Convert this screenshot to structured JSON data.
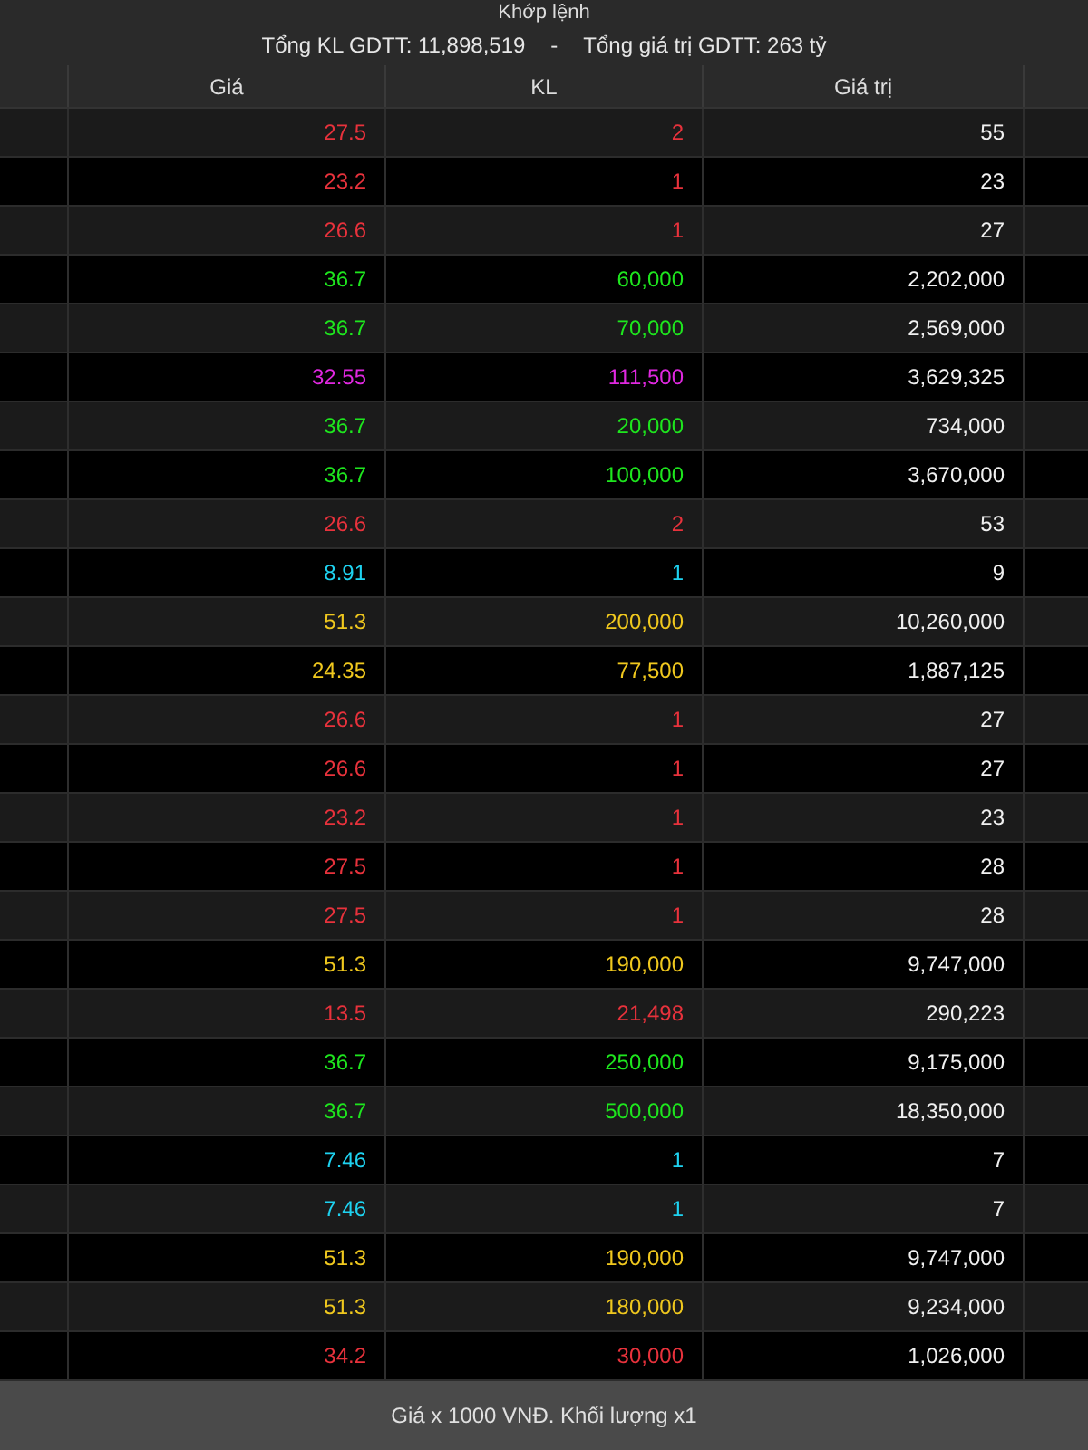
{
  "title": "Khớp lệnh",
  "summary": {
    "total_volume": "Tổng KL GDTT: 11,898,519",
    "separator": "-",
    "total_value": "Tổng giá trị GDTT: 263 tỷ"
  },
  "table": {
    "columns": [
      "Giá",
      "KL",
      "Giá trị"
    ],
    "rows": [
      {
        "price": "27.5",
        "volume": "2",
        "value": "55",
        "color": "#e8323c"
      },
      {
        "price": "23.2",
        "volume": "1",
        "value": "23",
        "color": "#e8323c"
      },
      {
        "price": "26.6",
        "volume": "1",
        "value": "27",
        "color": "#e8323c"
      },
      {
        "price": "36.7",
        "volume": "60,000",
        "value": "2,202,000",
        "color": "#1ee61e"
      },
      {
        "price": "36.7",
        "volume": "70,000",
        "value": "2,569,000",
        "color": "#1ee61e"
      },
      {
        "price": "32.55",
        "volume": "111,500",
        "value": "3,629,325",
        "color": "#e028e0"
      },
      {
        "price": "36.7",
        "volume": "20,000",
        "value": "734,000",
        "color": "#1ee61e"
      },
      {
        "price": "36.7",
        "volume": "100,000",
        "value": "3,670,000",
        "color": "#1ee61e"
      },
      {
        "price": "26.6",
        "volume": "2",
        "value": "53",
        "color": "#e8323c"
      },
      {
        "price": "8.91",
        "volume": "1",
        "value": "9",
        "color": "#1ed2f0"
      },
      {
        "price": "51.3",
        "volume": "200,000",
        "value": "10,260,000",
        "color": "#f0c81e"
      },
      {
        "price": "24.35",
        "volume": "77,500",
        "value": "1,887,125",
        "color": "#f0c81e"
      },
      {
        "price": "26.6",
        "volume": "1",
        "value": "27",
        "color": "#e8323c"
      },
      {
        "price": "26.6",
        "volume": "1",
        "value": "27",
        "color": "#e8323c"
      },
      {
        "price": "23.2",
        "volume": "1",
        "value": "23",
        "color": "#e8323c"
      },
      {
        "price": "27.5",
        "volume": "1",
        "value": "28",
        "color": "#e8323c"
      },
      {
        "price": "27.5",
        "volume": "1",
        "value": "28",
        "color": "#e8323c"
      },
      {
        "price": "51.3",
        "volume": "190,000",
        "value": "9,747,000",
        "color": "#f0c81e"
      },
      {
        "price": "13.5",
        "volume": "21,498",
        "value": "290,223",
        "color": "#e8323c"
      },
      {
        "price": "36.7",
        "volume": "250,000",
        "value": "9,175,000",
        "color": "#1ee61e"
      },
      {
        "price": "36.7",
        "volume": "500,000",
        "value": "18,350,000",
        "color": "#1ee61e"
      },
      {
        "price": "7.46",
        "volume": "1",
        "value": "7",
        "color": "#1ed2f0"
      },
      {
        "price": "7.46",
        "volume": "1",
        "value": "7",
        "color": "#1ed2f0"
      },
      {
        "price": "51.3",
        "volume": "190,000",
        "value": "9,747,000",
        "color": "#f0c81e"
      },
      {
        "price": "51.3",
        "volume": "180,000",
        "value": "9,234,000",
        "color": "#f0c81e"
      },
      {
        "price": "34.2",
        "volume": "30,000",
        "value": "1,026,000",
        "color": "#e8323c"
      }
    ]
  },
  "footer": "Giá x 1000 VNĐ. Khối lượng x1"
}
